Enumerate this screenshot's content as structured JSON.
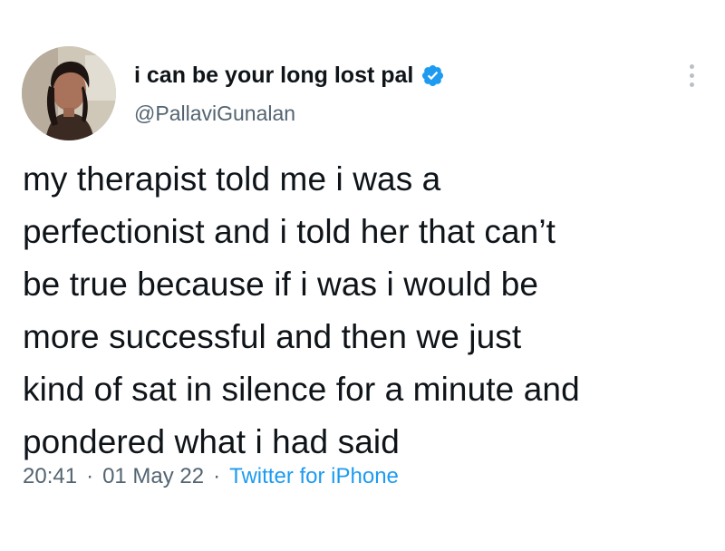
{
  "author": {
    "display_name": "i can be your long lost pal",
    "handle": "@PallaviGunalan",
    "verified": true,
    "verified_badge_color": "#1d9bf0",
    "avatar_icon": "profile-photo"
  },
  "tweet": {
    "text_lines": [
      "my therapist told me i was a",
      "perfectionist and i told her that can’t",
      "be true because if i was i would be",
      "more successful and then we just",
      "kind of sat in silence for a minute and",
      "pondered what i had said"
    ]
  },
  "meta": {
    "time": "20:41",
    "separator": "·",
    "date": "01 May 22",
    "source": "Twitter for iPhone"
  },
  "colors": {
    "text": "#0f1419",
    "secondary": "#536471",
    "link": "#1d9bf0",
    "background": "#ffffff"
  },
  "icons": {
    "more": "more-options-icon",
    "verified": "verified-badge-icon"
  }
}
